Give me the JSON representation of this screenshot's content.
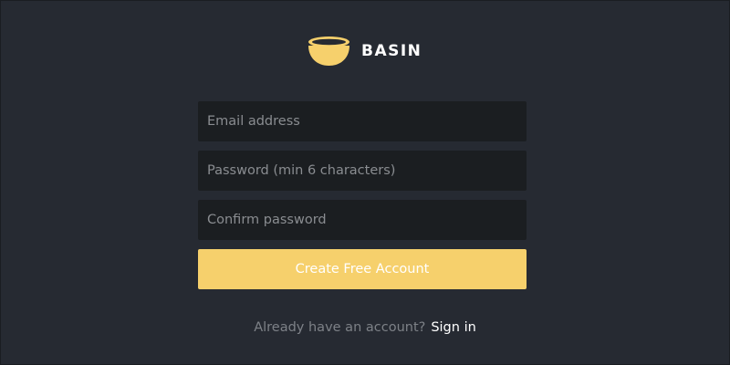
{
  "brand": {
    "name": "BASIN",
    "icon": "bowl-icon",
    "icon_color": "#f6d06c"
  },
  "form": {
    "email": {
      "placeholder": "Email address",
      "value": ""
    },
    "password": {
      "placeholder": "Password (min 6 characters)",
      "value": ""
    },
    "confirm_password": {
      "placeholder": "Confirm password",
      "value": ""
    },
    "submit_label": "Create Free Account",
    "submit_color": "#f6d06c"
  },
  "footer": {
    "prompt": "Already have an account?",
    "link_label": "Sign in"
  },
  "colors": {
    "background": "#262a32",
    "field_background": "#1b1e21"
  }
}
